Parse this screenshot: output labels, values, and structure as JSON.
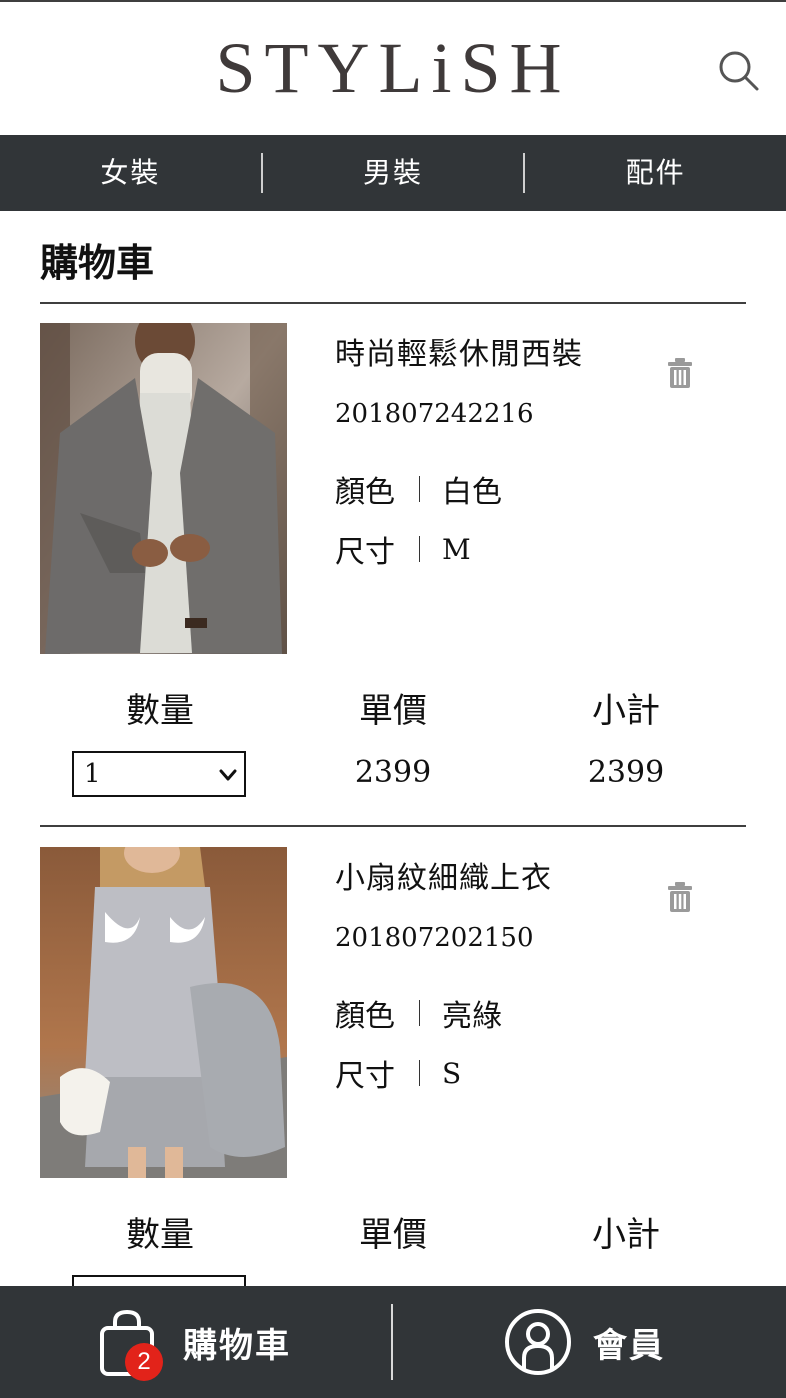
{
  "app": {
    "logo": "STYLiSH"
  },
  "nav": {
    "items": [
      "女裝",
      "男裝",
      "配件"
    ]
  },
  "page": {
    "title": "購物車"
  },
  "cart": {
    "labels": {
      "color": "顏色",
      "size": "尺寸",
      "quantity": "數量",
      "unit_price": "單價",
      "subtotal": "小計"
    },
    "items": [
      {
        "name": "時尚輕鬆休閒西裝",
        "id": "201807242216",
        "color": "白色",
        "size": "M",
        "quantity": "1",
        "unit_price": "2399",
        "subtotal": "2399"
      },
      {
        "name": "小扇紋細織上衣",
        "id": "201807202150",
        "color": "亮綠",
        "size": "S"
      }
    ]
  },
  "bottom_nav": {
    "cart_label": "購物車",
    "cart_count": "2",
    "member_label": "會員"
  },
  "icons": {
    "search": "search-icon",
    "trash": "trash-icon",
    "cart": "shopping-bag-icon",
    "member": "member-icon"
  },
  "colors": {
    "nav_bg": "#313538",
    "badge": "#e2231a",
    "trash": "#9a9a9a",
    "logo": "#3f3a3a"
  }
}
